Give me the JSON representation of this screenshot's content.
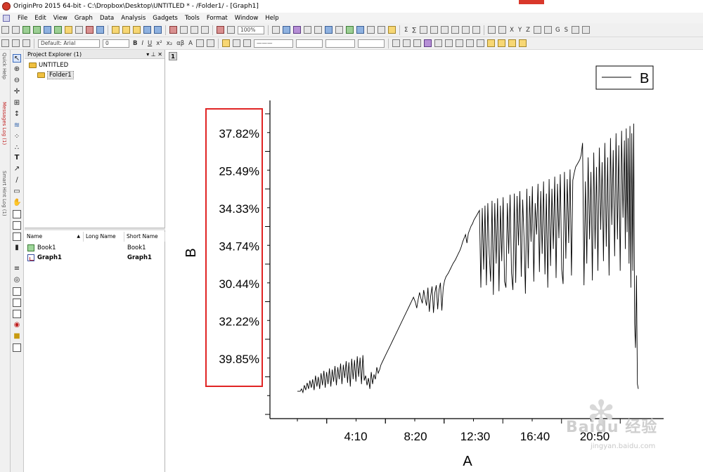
{
  "window": {
    "title": "OriginPro 2015 64-bit - C:\\Dropbox\\Desktop\\UNTITLED * - /Folder1/ - [Graph1]"
  },
  "menu": [
    "File",
    "Edit",
    "View",
    "Graph",
    "Data",
    "Analysis",
    "Gadgets",
    "Tools",
    "Format",
    "Window",
    "Help"
  ],
  "toolbar": {
    "zoom_value": "100%",
    "font_name": "Default: Arial",
    "font_size": "0",
    "glyphs": [
      "Σ",
      "∑",
      "X",
      "Y",
      "Z",
      "G",
      "S",
      "αβ",
      "A",
      "B",
      "I",
      "U",
      "x²",
      "x₂"
    ]
  },
  "side_tabs": [
    "Quick Help",
    "Messages Log (1)",
    "Smart Hint Log (1)"
  ],
  "project_explorer": {
    "title": "Project Explorer (1)",
    "tree": [
      "UNTITLED",
      "Folder1"
    ],
    "columns": [
      "Name",
      "Long Name",
      "Short Name"
    ],
    "items": [
      {
        "name": "Book1",
        "long_name": "",
        "short_name": "Book1"
      },
      {
        "name": "Graph1",
        "long_name": "",
        "short_name": "Graph1"
      }
    ]
  },
  "graph": {
    "layer_tab": "1",
    "highlight_color": "#e02424",
    "chart_data": {
      "type": "line",
      "xlabel": "A",
      "ylabel": "B",
      "legend": {
        "entries": [
          "B"
        ],
        "placement": "top-right"
      },
      "x_tick_labels": [
        "4:10",
        "8:20",
        "12:30",
        "16:40",
        "20:50"
      ],
      "y_tick_labels": [
        "37.82%",
        "25.49%",
        "34.33%",
        "34.74%",
        "30.44%",
        "32.22%",
        "39.85%"
      ],
      "grid": false,
      "xlim": [
        0,
        1500
      ],
      "ylim": [
        0,
        100
      ],
      "series": [
        {
          "name": "B",
          "x": [
            0,
            12,
            18,
            24,
            30,
            36,
            42,
            48,
            54,
            60,
            66,
            72,
            78,
            84,
            90,
            96,
            102,
            108,
            114,
            120,
            126,
            132,
            138,
            144,
            150,
            156,
            162,
            168,
            174,
            180,
            186,
            192,
            198,
            204,
            210,
            216,
            222,
            228,
            234,
            240,
            246,
            252,
            258,
            264,
            270,
            276,
            282,
            288,
            294,
            300,
            306,
            312,
            318,
            324,
            330,
            336,
            342,
            348,
            354,
            360,
            370,
            380,
            390,
            400,
            410,
            420,
            430,
            440,
            450,
            460,
            470,
            480,
            490,
            500,
            508,
            514,
            520,
            526,
            532,
            538,
            544,
            550,
            556,
            562,
            568,
            574,
            580,
            586,
            592,
            598,
            604,
            610,
            616,
            622,
            628,
            634,
            640,
            650,
            660,
            670,
            680,
            690,
            700,
            706,
            712,
            718,
            724,
            730,
            736,
            742,
            748,
            754,
            760,
            766,
            772,
            778,
            784,
            790,
            796,
            802,
            808,
            814,
            820,
            826,
            832,
            838,
            844,
            850,
            856,
            862,
            868,
            874,
            880,
            886,
            892,
            898,
            904,
            910,
            916,
            922,
            928,
            934,
            940,
            946,
            952,
            958,
            964,
            970,
            976,
            982,
            988,
            994,
            1000,
            1006,
            1012,
            1018,
            1024,
            1030,
            1036,
            1042,
            1048,
            1054,
            1060,
            1066,
            1072,
            1078,
            1084,
            1090,
            1096,
            1102,
            1108,
            1114,
            1120,
            1126,
            1132,
            1138,
            1144,
            1150,
            1156,
            1162,
            1168,
            1174,
            1180,
            1186,
            1192,
            1198,
            1204,
            1210,
            1216,
            1222,
            1228,
            1234,
            1240,
            1246,
            1252,
            1258,
            1264,
            1270,
            1276,
            1282,
            1288,
            1294,
            1300,
            1306,
            1312,
            1318,
            1324,
            1330,
            1336,
            1342,
            1348,
            1354,
            1360,
            1366,
            1372,
            1378,
            1384,
            1390,
            1396,
            1402,
            1408,
            1412,
            1416,
            1420,
            1424,
            1428,
            1432,
            1436,
            1440,
            1444,
            1448,
            1452,
            1456,
            1460,
            1464,
            1468
          ],
          "y": [
            4,
            4,
            6,
            3,
            9,
            5,
            11,
            6,
            13,
            7,
            14,
            5,
            17,
            8,
            16,
            6,
            19,
            9,
            21,
            7,
            20,
            10,
            23,
            8,
            22,
            12,
            25,
            9,
            24,
            14,
            27,
            10,
            26,
            15,
            29,
            11,
            28,
            8,
            31,
            14,
            30,
            12,
            33,
            16,
            32,
            10,
            34,
            13,
            17,
            9,
            15,
            6,
            20,
            10,
            18,
            14,
            24,
            19,
            22,
            26,
            30,
            34,
            38,
            42,
            46,
            50,
            54,
            58,
            62,
            66,
            70,
            74,
            78,
            82,
            78,
            73,
            80,
            86,
            81,
            77,
            88,
            81,
            75,
            90,
            70,
            83,
            91,
            69,
            86,
            92,
            72,
            88,
            94,
            71,
            90,
            96,
            99,
            102,
            106,
            110,
            113,
            117,
            121,
            124,
            128,
            131,
            134,
            127,
            135,
            138,
            141,
            143,
            146,
            148,
            150,
            152,
            154,
            90,
            156,
            105,
            158,
            92,
            160,
            118,
            95,
            162,
            84,
            160,
            110,
            164,
            87,
            158,
            112,
            165,
            95,
            90,
            160,
            118,
            167,
            102,
            88,
            168,
            94,
            166,
            125,
            170,
            99,
            163,
            130,
            85,
            172,
            106,
            166,
            128,
            174,
            95,
            160,
            134,
            176,
            103,
            170,
            118,
            178,
            101,
            168,
            90,
            180,
            108,
            172,
            122,
            182,
            98,
            176,
            131,
            184,
            105,
            93,
            186,
            114,
            180,
            127,
            188,
            100,
            179,
            185,
            190,
            192,
            194,
            196,
            200,
            210,
            92,
            178,
            110,
            198,
            130,
            186,
            96,
            202,
            122,
            190,
            104,
            206,
            138,
            194,
            112,
            210,
            124,
            198,
            100,
            214,
            142,
            204,
            116,
            218,
            130,
            208,
            104,
            220,
            148,
            212,
            122,
            222,
            136,
            214,
            110,
            224,
            90,
            218,
            104,
            226,
            60,
            40,
            100,
            10,
            6,
            28,
            18
          ]
        }
      ]
    }
  }
}
